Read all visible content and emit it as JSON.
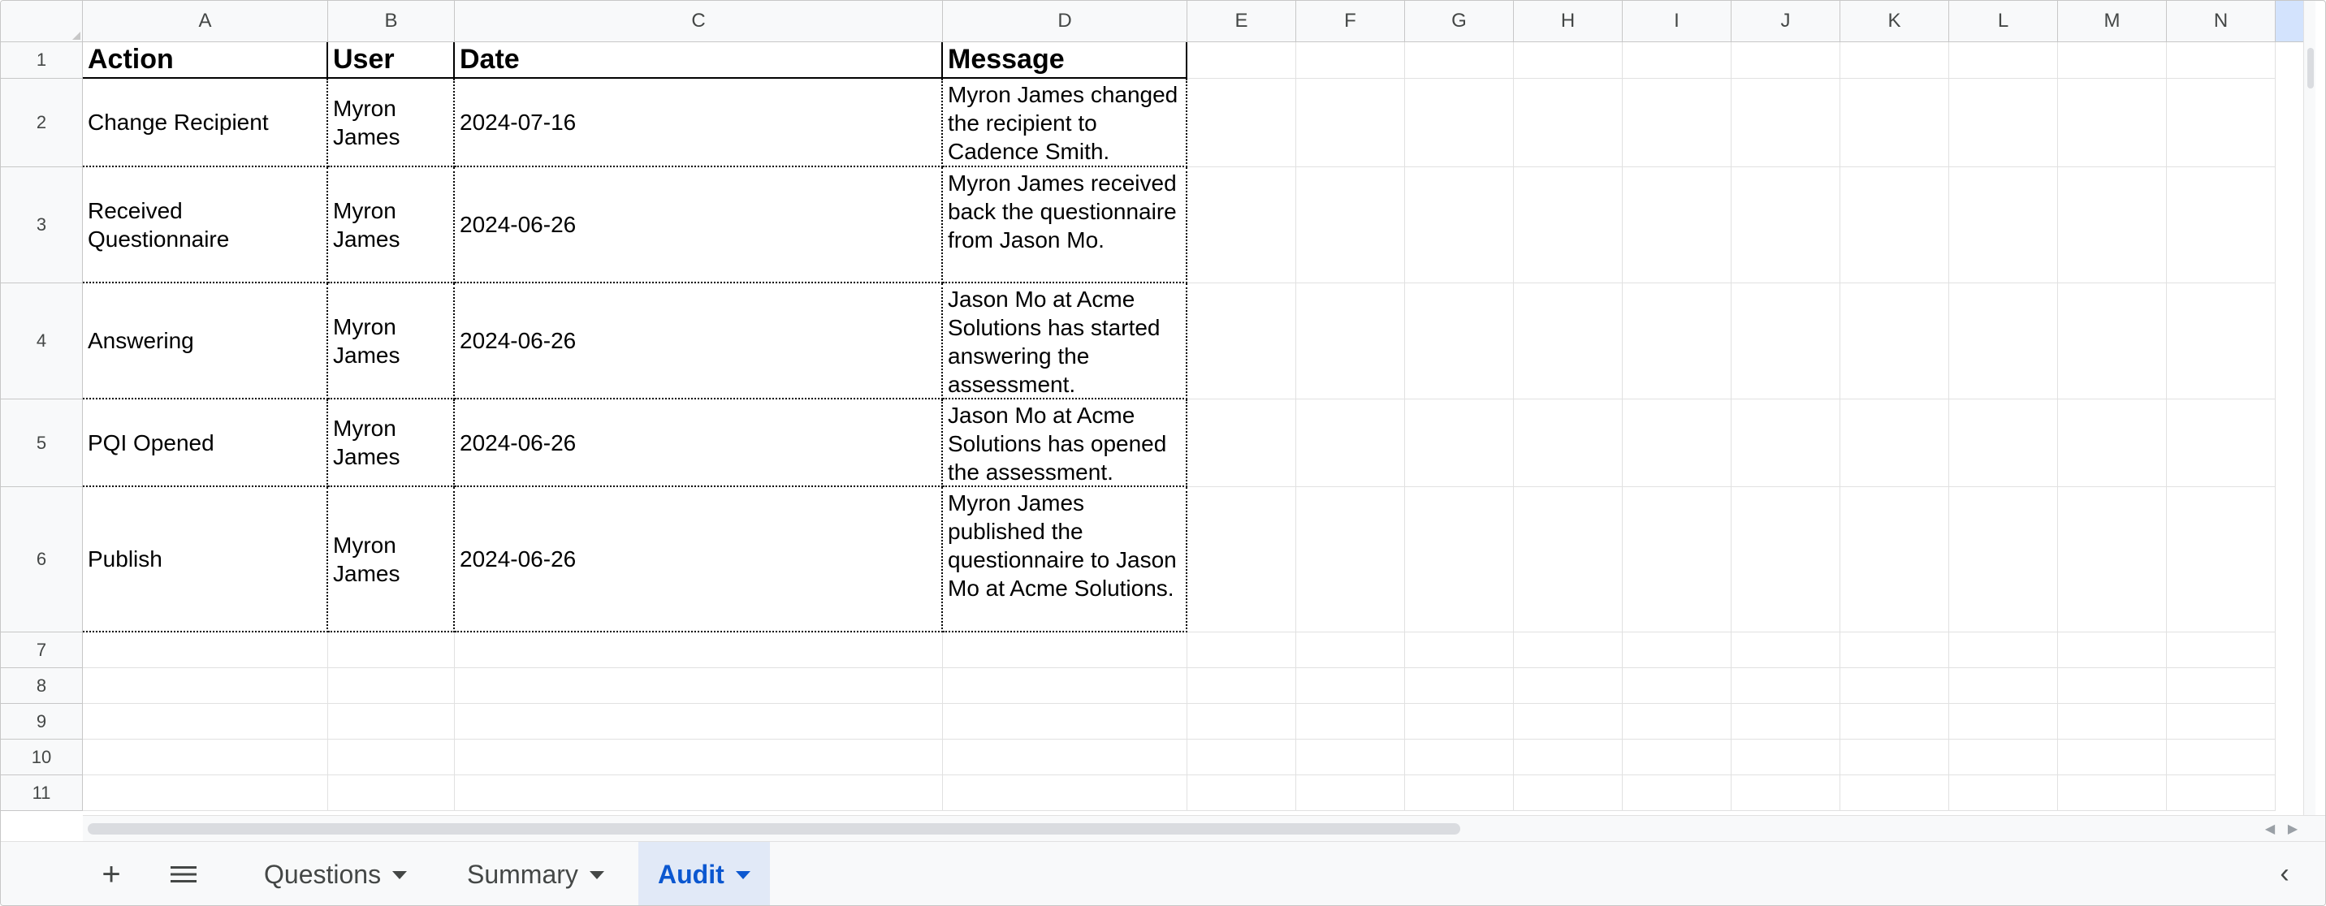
{
  "sheet": {
    "columns": [
      "A",
      "B",
      "C",
      "D",
      "E",
      "F",
      "G",
      "H",
      "I",
      "J",
      "K",
      "L",
      "M",
      "N"
    ],
    "row_numbers": [
      "1",
      "2",
      "3",
      "4",
      "5",
      "6",
      "7",
      "8",
      "9",
      "10",
      "11"
    ],
    "header_row": {
      "action": "Action",
      "user": "User",
      "date": "Date",
      "message": "Message"
    },
    "rows": [
      {
        "action": "Change Recipient",
        "user": "Myron James",
        "date": "2024-07-16",
        "message": "Myron James changed the recipient to Cadence Smith."
      },
      {
        "action": "Received Questionnaire",
        "user": "Myron James",
        "date": "2024-06-26",
        "message": "Myron James received back the questionnaire from Jason Mo."
      },
      {
        "action": "Answering",
        "user": "Myron James",
        "date": "2024-06-26",
        "message": "Jason Mo at Acme Solutions has started answering the assessment."
      },
      {
        "action": "PQI Opened",
        "user": "Myron James",
        "date": "2024-06-26",
        "message": "Jason Mo at Acme Solutions has opened the assessment."
      },
      {
        "action": "Publish",
        "user": "Myron James",
        "date": "2024-06-26",
        "message": "Myron James published the questionnaire to Jason Mo at Acme Solutions."
      }
    ]
  },
  "tabs": {
    "add_icon": "plus-icon",
    "list_icon": "hamburger-icon",
    "items": [
      {
        "label": "Questions"
      },
      {
        "label": "Summary"
      },
      {
        "label": "Audit"
      }
    ],
    "active": "Audit"
  },
  "colors": {
    "accent": "#0b57d0",
    "active_tab_bg": "#e1e9f7",
    "selected_col_header": "#d3e3fd"
  }
}
